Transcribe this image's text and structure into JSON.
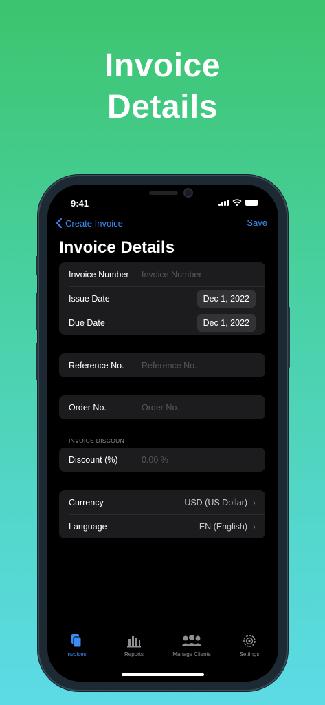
{
  "hero": {
    "line1": "Invoice",
    "line2": "Details"
  },
  "status_bar": {
    "time": "9:41"
  },
  "nav": {
    "back_label": "Create Invoice",
    "save_label": "Save"
  },
  "page_title": "Invoice Details",
  "invoice_group": {
    "invoice_number_label": "Invoice Number",
    "invoice_number_placeholder": "Invoice Number",
    "issue_date_label": "Issue Date",
    "issue_date_value": "Dec 1, 2022",
    "due_date_label": "Due Date",
    "due_date_value": "Dec 1, 2022"
  },
  "reference": {
    "label": "Reference No.",
    "placeholder": "Reference No."
  },
  "order": {
    "label": "Order No.",
    "placeholder": "Order No."
  },
  "discount": {
    "section_label": "INVOICE DISCOUNT",
    "label": "Discount (%)",
    "placeholder": "0.00 %"
  },
  "locale_group": {
    "currency_label": "Currency",
    "currency_value": "USD (US Dollar)",
    "language_label": "Language",
    "language_value": "EN (English)"
  },
  "tabs": [
    {
      "label": "Invoices",
      "icon": "document-icon",
      "active": true
    },
    {
      "label": "Reports",
      "icon": "bar-chart-icon",
      "active": false
    },
    {
      "label": "Manage Clients",
      "icon": "people-icon",
      "active": false
    },
    {
      "label": "Settings",
      "icon": "gear-icon",
      "active": false
    }
  ],
  "colors": {
    "accent": "#3d8bf5",
    "background_top": "#3dc46e",
    "background_bottom": "#5cdbe6"
  }
}
